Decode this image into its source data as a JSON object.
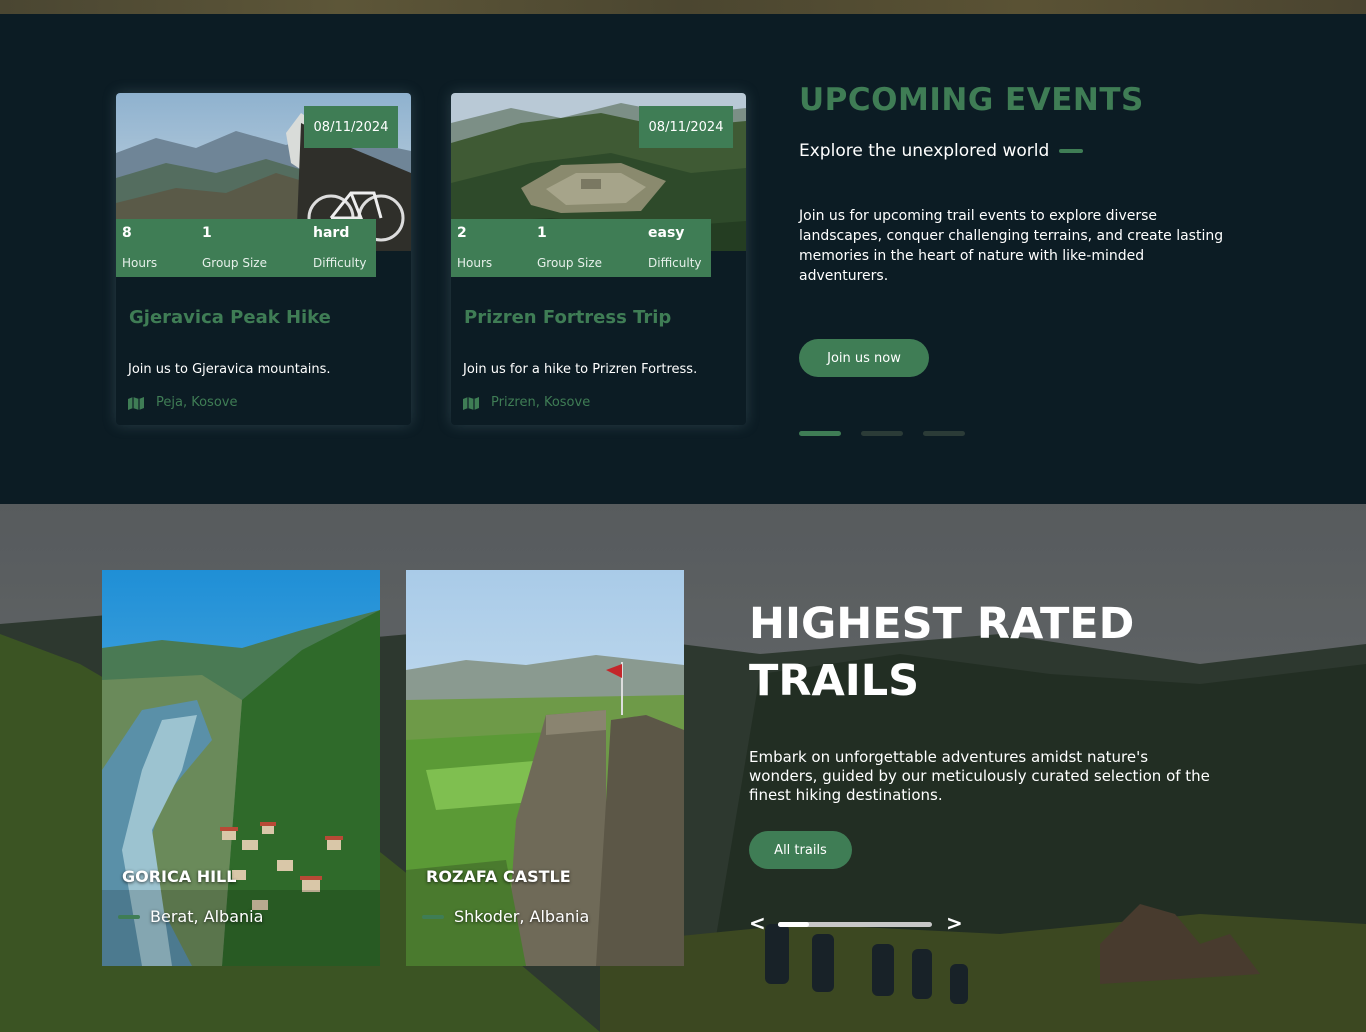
{
  "upcoming_events": {
    "title": "UPCOMING EVENTS",
    "subtitle": "Explore the unexplored world",
    "description": "Join us for upcoming trail events to explore diverse landscapes, conquer challenging terrains, and create lasting memories in the heart of nature with like-minded adventurers.",
    "cta_label": "Join us now",
    "carousel_pages": 3,
    "carousel_active": 1,
    "cards": [
      {
        "date": "08/11/2024",
        "hours_value": "8",
        "hours_label": "Hours",
        "group_value": "1",
        "group_label": "Group Size",
        "difficulty_value": "hard",
        "difficulty_label": "Difficulty",
        "title": "Gjeravica Peak Hike",
        "description": "Join us to Gjeravica mountains.",
        "location": "Peja, Kosove",
        "location_icon": "map-icon"
      },
      {
        "date": "08/11/2024",
        "hours_value": "2",
        "hours_label": "Hours",
        "group_value": "1",
        "group_label": "Group Size",
        "difficulty_value": "easy",
        "difficulty_label": "Difficulty",
        "title": "Prizren Fortress Trip",
        "description": "Join us for a hike to Prizren Fortress.",
        "location": "Prizren, Kosove",
        "location_icon": "map-icon"
      }
    ]
  },
  "highest_rated": {
    "title": "HIGHEST RATED TRAILS",
    "description": "Embark on unforgettable adventures amidst nature's wonders, guided by our meticulously curated selection of the finest hiking destinations.",
    "cta_label": "All trails",
    "prev_label": "<",
    "next_label": ">",
    "slider_progress": 0.2,
    "trails": [
      {
        "name": "GORICA HILL",
        "location": "Berat, Albania"
      },
      {
        "name": "ROZAFA CASTLE",
        "location": "Shkoder, Albania"
      }
    ]
  },
  "colors": {
    "accent": "#3f7d55",
    "dark_bg": "#0c1c24"
  }
}
